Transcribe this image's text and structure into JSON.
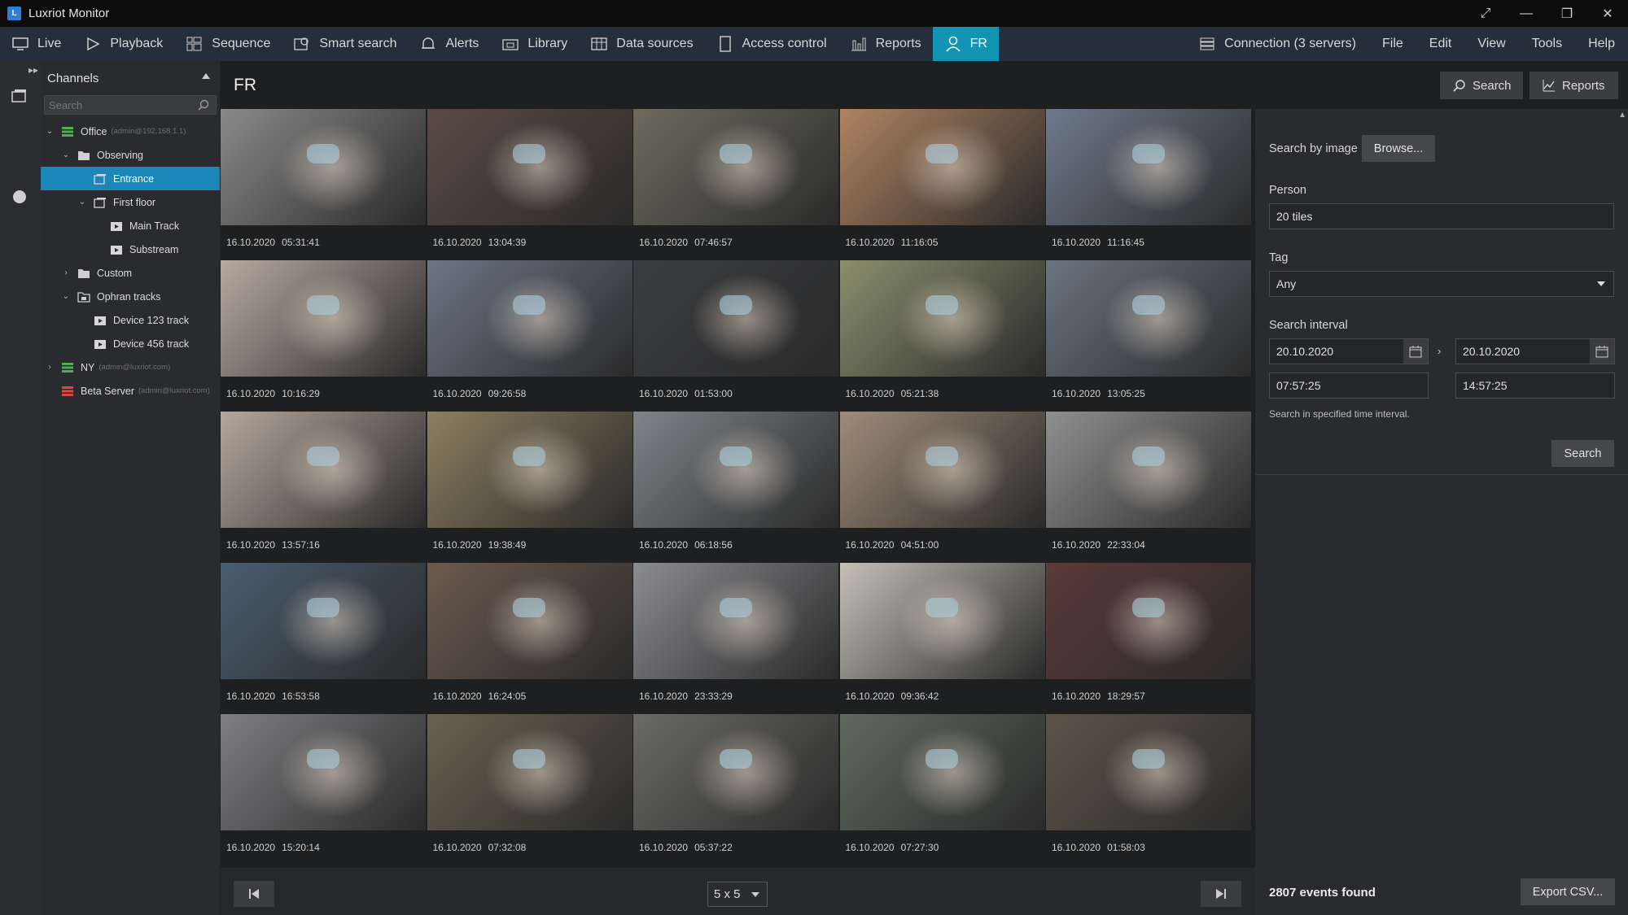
{
  "app": {
    "title": "Luxriot Monitor"
  },
  "window_controls": {
    "fullscreen": "⤢",
    "minimize": "—",
    "restore": "❐",
    "close": "✕"
  },
  "menu": {
    "items": [
      {
        "label": "Live",
        "icon": "monitor-icon"
      },
      {
        "label": "Playback",
        "icon": "play-icon"
      },
      {
        "label": "Sequence",
        "icon": "grid-icon"
      },
      {
        "label": "Smart search",
        "icon": "smart-search-icon"
      },
      {
        "label": "Alerts",
        "icon": "bell-icon"
      },
      {
        "label": "Library",
        "icon": "library-icon"
      },
      {
        "label": "Data sources",
        "icon": "data-sources-icon"
      },
      {
        "label": "Access control",
        "icon": "door-icon"
      },
      {
        "label": "Reports",
        "icon": "bar-chart-icon"
      },
      {
        "label": "FR",
        "icon": "person-icon",
        "active": true
      }
    ],
    "right": {
      "connection": "Connection (3 servers)",
      "file": "File",
      "edit": "Edit",
      "view": "View",
      "tools": "Tools",
      "help": "Help"
    },
    "active_color": "#1295b4"
  },
  "sidebar": {
    "title": "Channels",
    "search_placeholder": "Search",
    "tree": [
      {
        "label": "Office",
        "sub": "(admin@192.168.1.1)",
        "level": 0,
        "icon": "server-green-icon",
        "chev": "⌄"
      },
      {
        "label": "Observing",
        "level": 1,
        "icon": "folder-icon",
        "chev": "⌄"
      },
      {
        "label": "Entrance",
        "level": 2,
        "icon": "camera-group-icon",
        "selected": true
      },
      {
        "label": "First floor",
        "level": 2,
        "icon": "camera-group-icon",
        "chev": "⌄"
      },
      {
        "label": "Main Track",
        "level": 3,
        "icon": "video-icon"
      },
      {
        "label": "Substream",
        "level": 3,
        "icon": "video-icon"
      },
      {
        "label": "Custom",
        "level": 1,
        "icon": "folder-icon",
        "chev": "›"
      },
      {
        "label": "Ophran tracks",
        "level": 1,
        "icon": "folder-tracks-icon",
        "chev": "⌄"
      },
      {
        "label": "Device 123 track",
        "level": 2,
        "icon": "video-icon"
      },
      {
        "label": "Device 456 track",
        "level": 2,
        "icon": "video-icon"
      },
      {
        "label": "NY",
        "sub": "(admin@luxriot.com)",
        "level": 0,
        "icon": "server-green-icon",
        "chev": "›"
      },
      {
        "label": "Beta Server",
        "sub": "(admin@luxriot.com)",
        "level": 0,
        "icon": "server-red-icon"
      }
    ],
    "selected_color": "#1d86b8"
  },
  "main": {
    "title": "FR",
    "tiles": [
      {
        "date": "16.10.2020",
        "time": "05:31:41",
        "color": "#8a8a8a"
      },
      {
        "date": "16.10.2020",
        "time": "13:04:39",
        "color": "#5b4a44"
      },
      {
        "date": "16.10.2020",
        "time": "07:46:57",
        "color": "#6d6b5e"
      },
      {
        "date": "16.10.2020",
        "time": "11:16:05",
        "color": "#b08461"
      },
      {
        "date": "16.10.2020",
        "time": "11:16:45",
        "color": "#6e7a8c"
      },
      {
        "date": "16.10.2020",
        "time": "10:16:29",
        "color": "#b7aaa0"
      },
      {
        "date": "16.10.2020",
        "time": "09:26:58",
        "color": "#6c7686"
      },
      {
        "date": "16.10.2020",
        "time": "01:53:00",
        "color": "#3b3d40"
      },
      {
        "date": "16.10.2020",
        "time": "05:21:38",
        "color": "#8b8f6c"
      },
      {
        "date": "16.10.2020",
        "time": "13:05:25",
        "color": "#6b7480"
      },
      {
        "date": "16.10.2020",
        "time": "13:57:16",
        "color": "#b5a79c"
      },
      {
        "date": "16.10.2020",
        "time": "19:38:49",
        "color": "#8d7f5f"
      },
      {
        "date": "16.10.2020",
        "time": "06:18:56",
        "color": "#7f8489"
      },
      {
        "date": "16.10.2020",
        "time": "04:51:00",
        "color": "#a08c78"
      },
      {
        "date": "16.10.2020",
        "time": "22:33:04",
        "color": "#909090"
      },
      {
        "date": "16.10.2020",
        "time": "16:53:58",
        "color": "#4a5d6f"
      },
      {
        "date": "16.10.2020",
        "time": "16:24:05",
        "color": "#6b5a4e"
      },
      {
        "date": "16.10.2020",
        "time": "23:33:29",
        "color": "#8b8c90"
      },
      {
        "date": "16.10.2020",
        "time": "09:36:42",
        "color": "#c4c0b8"
      },
      {
        "date": "16.10.2020",
        "time": "18:29:57",
        "color": "#5b3a3a"
      },
      {
        "date": "16.10.2020",
        "time": "15:20:14",
        "color": "#7e7f82"
      },
      {
        "date": "16.10.2020",
        "time": "07:32:08",
        "color": "#6a6150"
      },
      {
        "date": "16.10.2020",
        "time": "05:37:22",
        "color": "#6b6a66"
      },
      {
        "date": "16.10.2020",
        "time": "07:27:30",
        "color": "#5f6a60"
      },
      {
        "date": "16.10.2020",
        "time": "01:58:03",
        "color": "#5d5449"
      }
    ],
    "pager": {
      "layout": "5 x 5"
    }
  },
  "panel": {
    "search_btn": "Search",
    "reports_btn": "Reports",
    "search_by_image": "Search by image",
    "browse": "Browse...",
    "person_label": "Person",
    "person_value": "20 tiles",
    "tag_label": "Tag",
    "tag_value": "Any",
    "interval_label": "Search interval",
    "from_date": "20.10.2020",
    "to_date": "20.10.2020",
    "from_time": "07:57:25",
    "to_time": "14:57:25",
    "interval_hint": "Search in specified time interval.",
    "search": "Search",
    "events_found": "2807 events found",
    "export": "Export CSV..."
  }
}
